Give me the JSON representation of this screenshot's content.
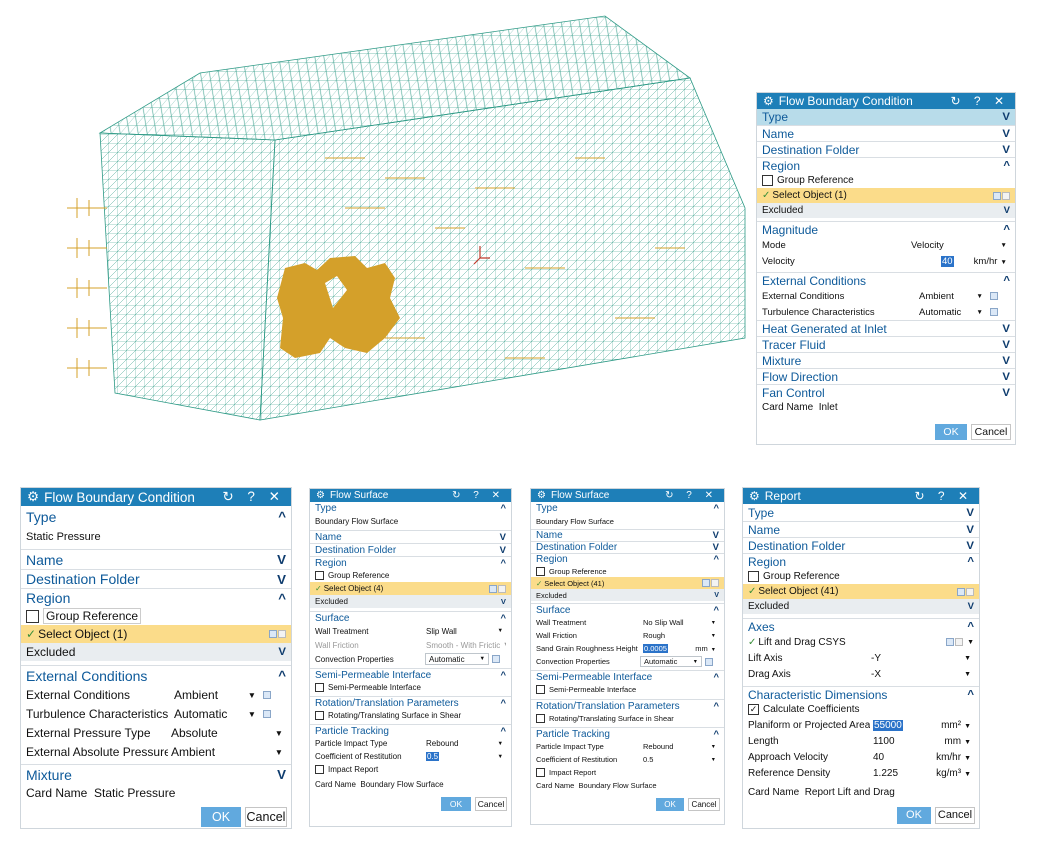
{
  "panel_main": {
    "title": "Flow Boundary Condition",
    "controls": "↻ ? ✕",
    "sections": {
      "type": "Type",
      "name": "Name",
      "destination": "Destination Folder",
      "region": "Region",
      "magnitude": "Magnitude",
      "external": "External Conditions",
      "heat": "Heat Generated at Inlet",
      "tracer": "Tracer Fluid",
      "mixture": "Mixture",
      "flow_direction": "Flow Direction",
      "fan": "Fan Control"
    },
    "group_reference": "Group Reference",
    "select_object": "Select Object (1)",
    "excluded": "Excluded",
    "mode_label": "Mode",
    "mode_value": "Velocity",
    "velocity_label": "Velocity",
    "velocity_value": "40",
    "velocity_unit": "km/hr",
    "ext_cond_label": "External Conditions",
    "ext_cond_value": "Ambient",
    "turb_label": "Turbulence Characteristics",
    "turb_value": "Automatic",
    "card_name_label": "Card Name",
    "card_name_value": "Inlet",
    "ok": "OK",
    "cancel": "Cancel"
  },
  "panel_static": {
    "title": "Flow Boundary Condition",
    "controls": "↻ ? ✕",
    "type": "Type",
    "type_value": "Static Pressure",
    "name": "Name",
    "destination": "Destination Folder",
    "region": "Region",
    "group_reference": "Group Reference",
    "select_object": "Select Object (1)",
    "excluded": "Excluded",
    "external": "External Conditions",
    "ext_cond_label": "External Conditions",
    "ext_cond_value": "Ambient",
    "turb_label": "Turbulence Characteristics",
    "turb_value": "Automatic",
    "ext_press_type_label": "External Pressure Type",
    "ext_press_type_value": "Absolute",
    "ext_abs_press_label": "External Absolute Pressure",
    "ext_abs_press_value": "Ambient",
    "mixture": "Mixture",
    "card_name_label": "Card Name",
    "card_name_value": "Static Pressure",
    "ok": "OK",
    "cancel": "Cancel"
  },
  "panel_surface1": {
    "title": "Flow Surface",
    "controls": "↻ ? ✕",
    "type": "Type",
    "type_value": "Boundary Flow Surface",
    "name": "Name",
    "destination": "Destination Folder",
    "region": "Region",
    "group_reference": "Group Reference",
    "select_object": "Select Object (4)",
    "excluded": "Excluded",
    "surface": "Surface",
    "wall_treatment_label": "Wall Treatment",
    "wall_treatment_value": "Slip Wall",
    "wall_friction_label": "Wall Friction",
    "wall_friction_value": "Smooth - With Frictic",
    "convection_label": "Convection Properties",
    "convection_value": "Automatic",
    "semi": "Semi-Permeable Interface",
    "semi_check": "Semi-Permeable Interface",
    "rotation": "Rotation/Translation Parameters",
    "rotation_check": "Rotating/Translating Surface in Shear",
    "particle": "Particle Tracking",
    "impact_type_label": "Particle Impact Type",
    "impact_type_value": "Rebound",
    "restitution_label": "Coefficient of Restitution",
    "restitution_value": "0.5",
    "impact_report": "Impact Report",
    "card_name_label": "Card Name",
    "card_name_value": "Boundary Flow Surface",
    "ok": "OK",
    "cancel": "Cancel"
  },
  "panel_surface2": {
    "title": "Flow Surface",
    "controls": "↻ ? ✕",
    "type": "Type",
    "type_value": "Boundary Flow Surface",
    "name": "Name",
    "destination": "Destination Folder",
    "region": "Region",
    "group_reference": "Group Reference",
    "select_object": "Select Object (41)",
    "excluded": "Excluded",
    "surface": "Surface",
    "wall_treatment_label": "Wall Treatment",
    "wall_treatment_value": "No Slip Wall",
    "wall_friction_label": "Wall Friction",
    "wall_friction_value": "Rough",
    "roughness_label": "Sand Grain Roughness Height",
    "roughness_value": "0.0005",
    "roughness_unit": "mm",
    "convection_label": "Convection Properties",
    "convection_value": "Automatic",
    "semi": "Semi-Permeable Interface",
    "semi_check": "Semi-Permeable Interface",
    "rotation": "Rotation/Translation Parameters",
    "rotation_check": "Rotating/Translating Surface in Shear",
    "particle": "Particle Tracking",
    "impact_type_label": "Particle Impact Type",
    "impact_type_value": "Rebound",
    "restitution_label": "Coefficient of Restitution",
    "restitution_value": "0.5",
    "impact_report": "Impact Report",
    "card_name_label": "Card Name",
    "card_name_value": "Boundary Flow Surface",
    "ok": "OK",
    "cancel": "Cancel"
  },
  "panel_report": {
    "title": "Report",
    "controls": "↻ ? ✕",
    "type": "Type",
    "name": "Name",
    "destination": "Destination Folder",
    "region": "Region",
    "group_reference": "Group Reference",
    "select_object": "Select Object (41)",
    "excluded": "Excluded",
    "axes": "Axes",
    "csys": "Lift and Drag CSYS",
    "lift_axis_label": "Lift Axis",
    "lift_axis_value": "-Y",
    "drag_axis_label": "Drag Axis",
    "drag_axis_value": "-X",
    "char_dims": "Characteristic Dimensions",
    "calc_coeff": "Calculate Coefficients",
    "area_label": "Planiform or Projected Area",
    "area_value": "55000",
    "area_unit": "mm²",
    "length_label": "Length",
    "length_value": "1100",
    "length_unit": "mm",
    "approach_label": "Approach Velocity",
    "approach_value": "40",
    "approach_unit": "km/hr",
    "density_label": "Reference Density",
    "density_value": "1.225",
    "density_unit": "kg/m³",
    "card_name_label": "Card Name",
    "card_name_value": "Report Lift and Drag",
    "ok": "OK",
    "cancel": "Cancel"
  },
  "colors": {
    "title_bar": "#1e7fb8",
    "section_text": "#0e5a9a",
    "selected_row": "#fbdc8a",
    "mesh": "#2e9a86",
    "body": "#d4a02a"
  }
}
